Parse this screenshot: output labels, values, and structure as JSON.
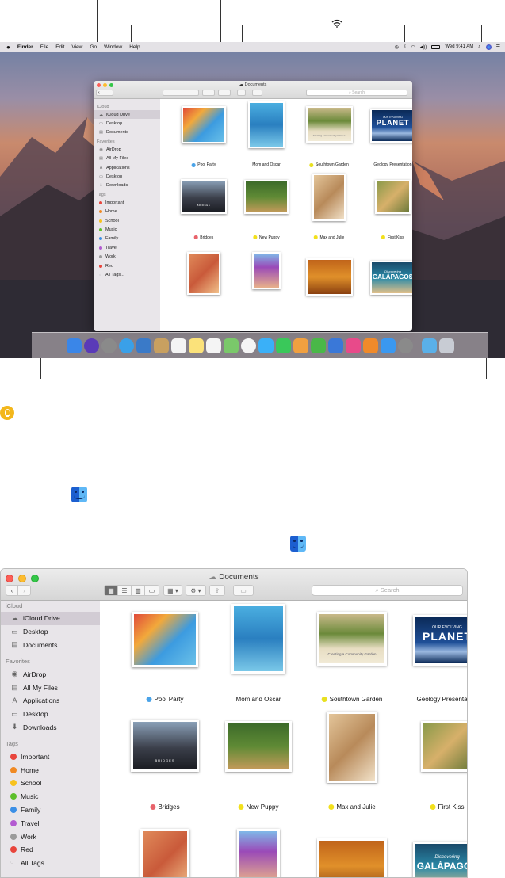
{
  "menubar": {
    "apple": "",
    "items": [
      "Finder",
      "File",
      "Edit",
      "View",
      "Go",
      "Window",
      "Help"
    ],
    "clock": "Wed 9:41 AM"
  },
  "window_small": {
    "title": "Documents",
    "search_placeholder": "Search",
    "sidebar": {
      "icloud_header": "iCloud",
      "icloud": [
        "iCloud Drive",
        "Desktop",
        "Documents"
      ],
      "favorites_header": "Favorites",
      "favorites": [
        "AirDrop",
        "All My Files",
        "Applications",
        "Desktop",
        "Downloads"
      ],
      "tags_header": "Tags",
      "tags": [
        "Important",
        "Home",
        "School",
        "Music",
        "Family",
        "Travel",
        "Work",
        "Red",
        "All Tags..."
      ]
    }
  },
  "window_large": {
    "title": "Documents",
    "search_placeholder": "Search",
    "sidebar": {
      "icloud_header": "iCloud",
      "icloud": [
        "iCloud Drive",
        "Desktop",
        "Documents"
      ],
      "favorites_header": "Favorites",
      "favorites": [
        "AirDrop",
        "All My Files",
        "Applications",
        "Desktop",
        "Downloads"
      ],
      "tags_header": "Tags",
      "tags": [
        "Important",
        "Home",
        "School",
        "Music",
        "Family",
        "Travel",
        "Work",
        "Red",
        "All Tags..."
      ]
    }
  },
  "tag_colors": {
    "Important": "#e8453c",
    "Home": "#f08a24",
    "School": "#f7c21d",
    "Music": "#5cbf2a",
    "Family": "#3b8fe6",
    "Travel": "#b35bd1",
    "Work": "#9b9b9b",
    "Red": "#e8453c"
  },
  "files": [
    {
      "name": "Pool Party",
      "tag_color": "#4aa3e8",
      "thumb_style": "photo"
    },
    {
      "name": "Mom and Oscar",
      "tag_color": "",
      "thumb_style": "photo"
    },
    {
      "name": "Southtown Garden",
      "tag_color": "#e8e020",
      "thumb_style": "doc"
    },
    {
      "name": "Geology Presentation",
      "tag_color": "",
      "thumb_style": "slide"
    },
    {
      "name": "Bridges",
      "tag_color": "#e8636b",
      "thumb_style": "doc"
    },
    {
      "name": "New Puppy",
      "tag_color": "#f2e01c",
      "thumb_style": "photo"
    },
    {
      "name": "Max and Julie",
      "tag_color": "#f2e01c",
      "thumb_style": "photo"
    },
    {
      "name": "First Kiss",
      "tag_color": "#f2e01c",
      "thumb_style": "photo"
    },
    {
      "name": "",
      "tag_color": "",
      "thumb_style": "photo"
    },
    {
      "name": "",
      "tag_color": "",
      "thumb_style": "photo"
    },
    {
      "name": "",
      "tag_color": "",
      "thumb_style": "doc"
    },
    {
      "name": "",
      "tag_color": "",
      "thumb_style": "slide"
    }
  ],
  "thumb_texts": {
    "geology_l1": "OUR EVOLVING",
    "geology_l2": "PLANET",
    "galapagos_l1": "Discovering",
    "galapagos_l2": "GALÁPAGOS",
    "garden": "Creating a Community Garden",
    "bridges": "BRIDGES"
  },
  "dock_icons": [
    "finder-icon",
    "siri-icon",
    "launchpad-icon",
    "safari-icon",
    "photo-browser-icon",
    "contacts-icon",
    "calendar-icon",
    "notes-icon",
    "reminders-icon",
    "maps-icon",
    "photos-icon",
    "messages-icon",
    "facetime-icon",
    "pages-icon",
    "numbers-icon",
    "keynote-icon",
    "itunes-icon",
    "ibooks-icon",
    "app-store-icon",
    "system-preferences-icon",
    "downloads-folder-icon",
    "trash-icon"
  ]
}
